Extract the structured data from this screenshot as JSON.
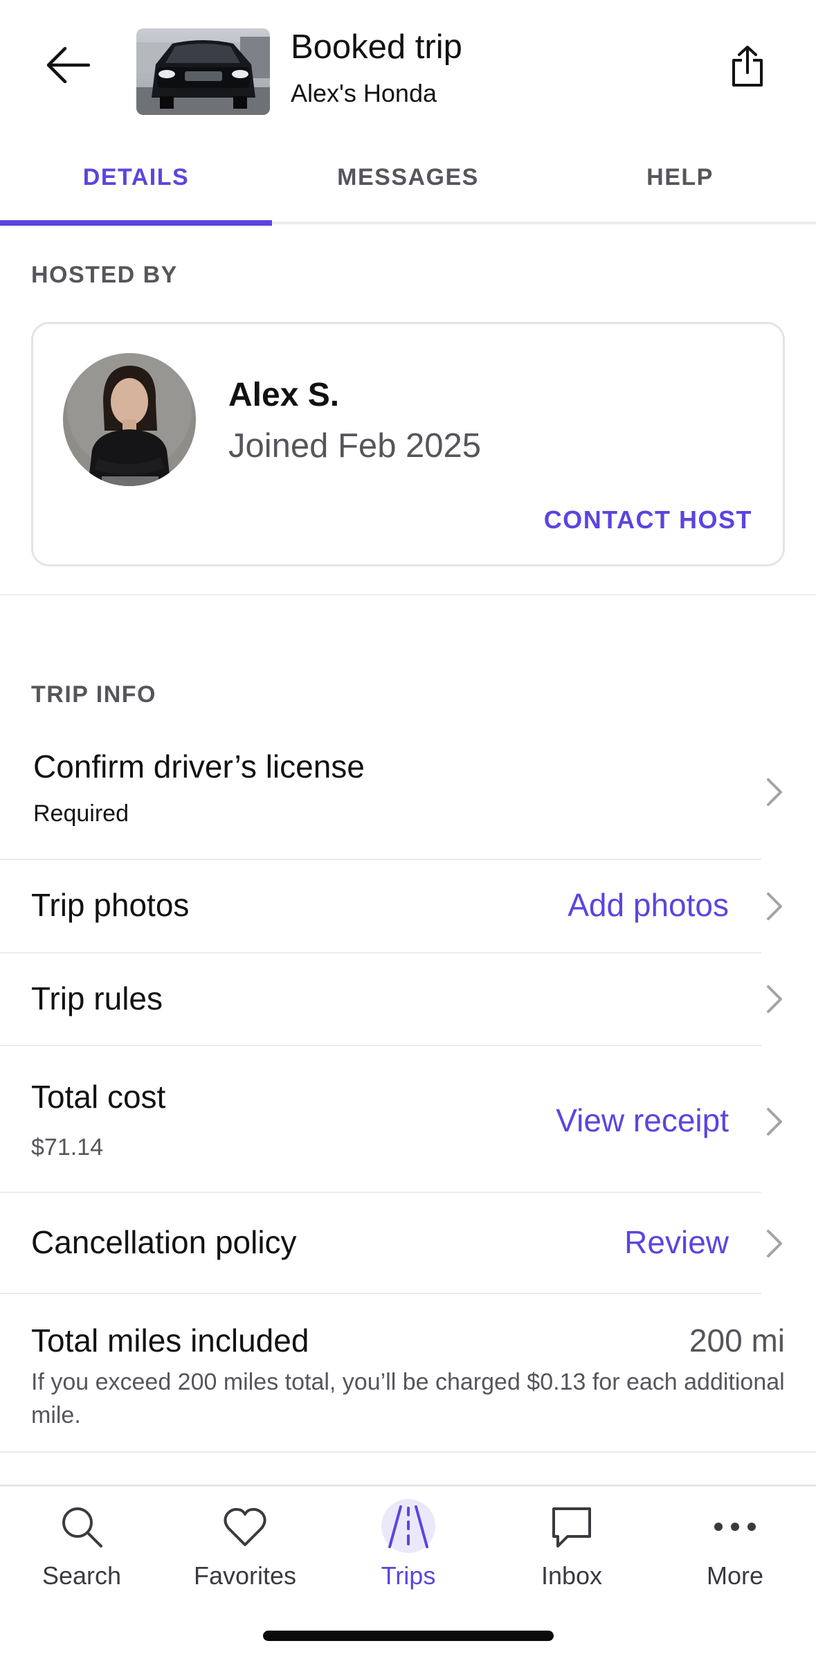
{
  "header": {
    "title": "Booked trip",
    "subtitle": "Alex's Honda"
  },
  "tabs": [
    {
      "label": "DETAILS",
      "active": true
    },
    {
      "label": "MESSAGES",
      "active": false
    },
    {
      "label": "HELP",
      "active": false
    }
  ],
  "hosted_by": {
    "section_label": "HOSTED BY",
    "host_name": "Alex S.",
    "joined": "Joined Feb 2025",
    "contact_label": "CONTACT HOST"
  },
  "trip_info": {
    "section_label": "TRIP INFO",
    "license": {
      "title": "Confirm driver’s license",
      "subtitle": "Required"
    },
    "photos": {
      "title": "Trip photos",
      "action": "Add photos"
    },
    "rules": {
      "title": "Trip rules"
    },
    "cost": {
      "title": "Total cost",
      "amount": "$71.14",
      "action": "View receipt"
    },
    "cancellation": {
      "title": "Cancellation policy",
      "action": "Review"
    },
    "miles": {
      "title": "Total miles included",
      "value": "200 mi",
      "note": "If you exceed 200 miles total, you’ll be charged $0.13 for each additional mile."
    }
  },
  "bottom_nav": [
    {
      "label": "Search",
      "icon": "search-icon"
    },
    {
      "label": "Favorites",
      "icon": "heart-icon"
    },
    {
      "label": "Trips",
      "icon": "road-icon",
      "active": true
    },
    {
      "label": "Inbox",
      "icon": "chat-bubble-icon"
    },
    {
      "label": "More",
      "icon": "more-dots-icon"
    }
  ],
  "colors": {
    "accent": "#5a45e0",
    "text": "#121214",
    "muted": "#55555c",
    "divider": "#ececef"
  }
}
